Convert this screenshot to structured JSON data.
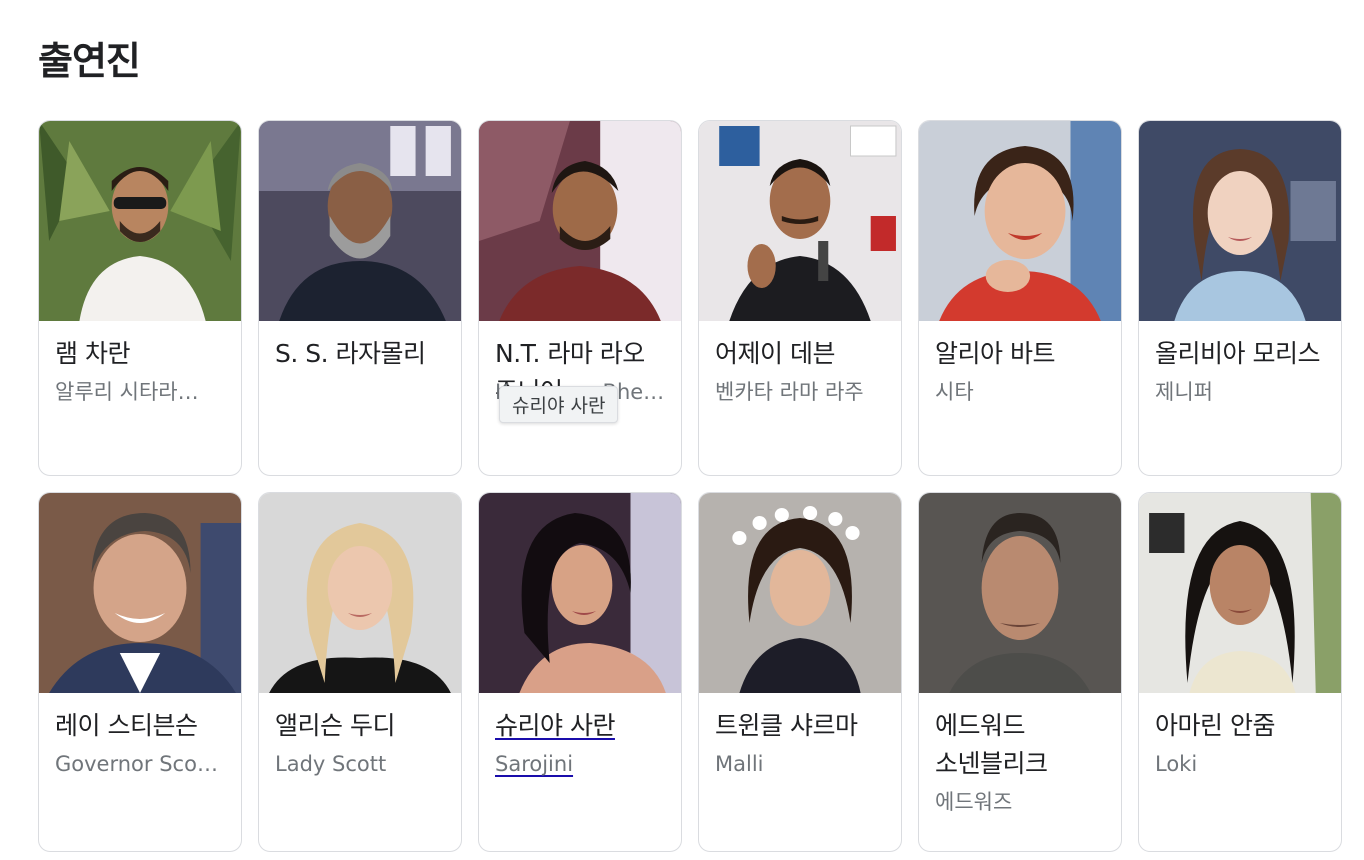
{
  "section": {
    "title": "출연진"
  },
  "tooltip": "슈리야 사란",
  "cast": [
    {
      "name": "램 차란",
      "role": "알루리 시타라…"
    },
    {
      "name": "S. S. 라자몰리",
      "role": ""
    },
    {
      "name": "N.T. 라마 라오 주니어",
      "role": "Komaram Bhe…"
    },
    {
      "name": "어제이 데븐",
      "role": "벤카타 라마 라주"
    },
    {
      "name": "알리아 바트",
      "role": "시타"
    },
    {
      "name": "올리비아 모리스",
      "role": "제니퍼"
    },
    {
      "name": "레이 스티븐슨",
      "role": "Governor Scot…"
    },
    {
      "name": "앨리슨 두디",
      "role": "Lady Scott"
    },
    {
      "name": "슈리야 사란",
      "role": "Sarojini"
    },
    {
      "name": "트윈클 샤르마",
      "role": "Malli"
    },
    {
      "name": "에드워드 소넨블리크",
      "role": "에드워즈"
    },
    {
      "name": "아마린 안줌",
      "role": "Loki"
    }
  ]
}
